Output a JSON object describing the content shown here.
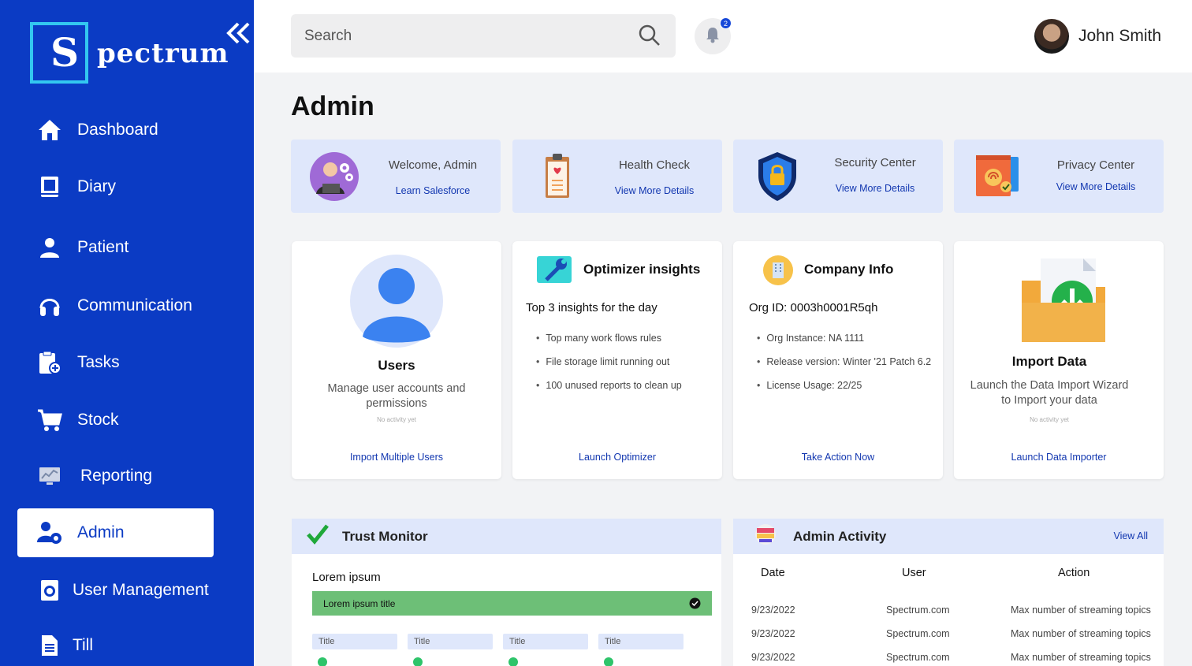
{
  "app": {
    "logo_letter": "S",
    "logo_rest": "pectrum"
  },
  "sidebar": {
    "items": [
      {
        "label": "Dashboard",
        "icon": "home-icon"
      },
      {
        "label": "Diary",
        "icon": "book-icon"
      },
      {
        "label": "Patient",
        "icon": "person-icon"
      },
      {
        "label": "Communication",
        "icon": "headphones-icon"
      },
      {
        "label": "Tasks",
        "icon": "clipboard-add-icon"
      },
      {
        "label": "Stock",
        "icon": "cart-icon"
      },
      {
        "label": "Reporting",
        "icon": "monitor-chart-icon"
      },
      {
        "label": "Admin",
        "icon": "user-gear-icon",
        "active": true
      },
      {
        "label": "User Management",
        "icon": "user-management-icon"
      },
      {
        "label": "Till",
        "icon": "document-icon"
      }
    ]
  },
  "header": {
    "search_placeholder": "Search",
    "notification_count": "2",
    "user_name": "John Smith"
  },
  "page": {
    "title": "Admin"
  },
  "summary_cards": [
    {
      "title": "Welcome, Admin",
      "link": "Learn Salesforce",
      "icon": "admin-avatar-icon"
    },
    {
      "title": "Health Check",
      "link": "View More Details",
      "icon": "health-clipboard-icon"
    },
    {
      "title": "Security Center",
      "link": "View More Details",
      "icon": "shield-lock-icon"
    },
    {
      "title": "Privacy Center",
      "link": "View More Details",
      "icon": "fingerprint-icon"
    }
  ],
  "tiles": {
    "users": {
      "title": "Users",
      "desc": "Manage user accounts and permissions",
      "note": "No activity yet",
      "link": "Import Multiple Users"
    },
    "optimizer": {
      "title": "Optimizer insights",
      "subtitle": "Top 3 insights for the day",
      "items": [
        "Top many work flows rules",
        "File storage limit running out",
        "100 unused reports to clean up"
      ],
      "link": "Launch Optimizer"
    },
    "company": {
      "title": "Company Info",
      "subtitle": "Org ID: 0003h0001R5qh",
      "items": [
        "Org Instance: NA 1111",
        "Release version: Winter '21 Patch 6.2",
        "License Usage: 22/25"
      ],
      "link": "Take Action Now"
    },
    "import": {
      "title": "Import Data",
      "desc": "Launch the Data Import Wizard to Import your data",
      "note": "No activity yet",
      "link": "Launch Data Importer"
    }
  },
  "trust_monitor": {
    "title": "Trust Monitor",
    "section": "Lorem ipsum",
    "bar_label": "Lorem ipsum title",
    "mini_titles": [
      "Title",
      "Title",
      "Title",
      "Title"
    ]
  },
  "admin_activity": {
    "title": "Admin Activity",
    "view_all": "View All",
    "columns": [
      "Date",
      "User",
      "Action"
    ],
    "rows": [
      [
        "9/23/2022",
        "Spectrum.com",
        "Max number of streaming topics"
      ],
      [
        "9/23/2022",
        "Spectrum.com",
        "Max number of streaming topics"
      ],
      [
        "9/23/2022",
        "Spectrum.com",
        "Max number of streaming topics"
      ]
    ]
  },
  "colors": {
    "sidebar": "#0b3bc4",
    "accent_link": "#1237b0",
    "card_bg": "#dfe7fb",
    "success": "#6dbf77"
  }
}
